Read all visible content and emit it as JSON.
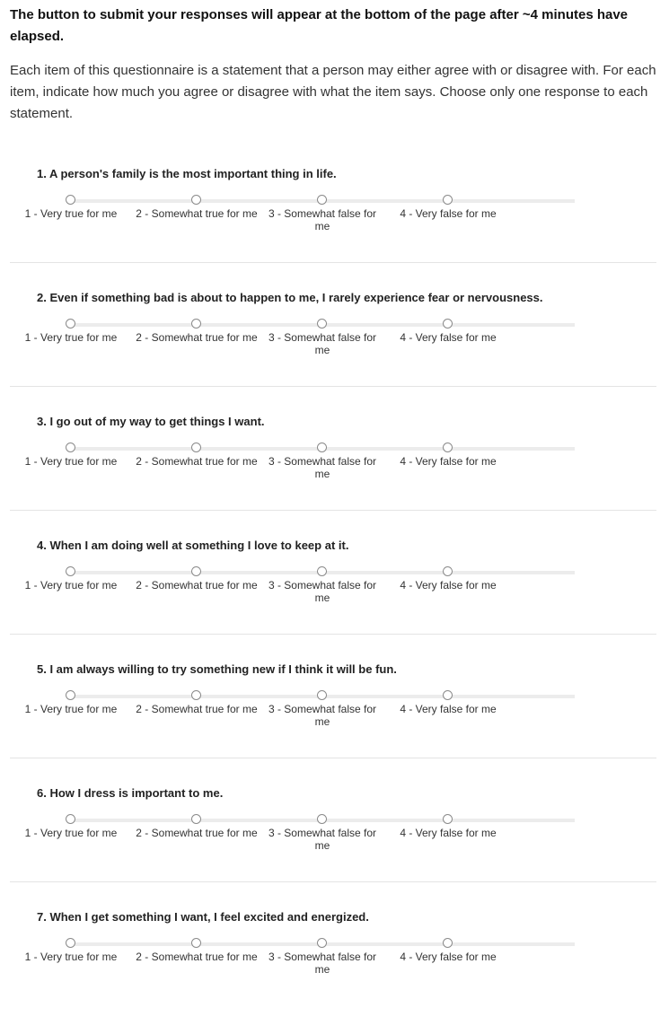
{
  "notice": "The button to submit your responses will appear at the bottom of the page after ~4 minutes have elapsed.",
  "instructions": "Each item of this questionnaire is a statement that a person may either agree with or disagree with. For each item, indicate how much you agree or disagree with what the item says. Choose only one response to each statement.",
  "options": [
    "1 - Very true for me",
    "2 - Somewhat true for me",
    "3 - Somewhat false for me",
    "4 - Very false for me"
  ],
  "questions": [
    {
      "text": "1. A person's family is the most important thing in life.",
      "selected": null
    },
    {
      "text": "2. Even if something bad is about to happen to me, I rarely experience fear or nervousness.",
      "selected": null
    },
    {
      "text": "3. I go out of my way to get things I want.",
      "selected": null
    },
    {
      "text": "4. When I am doing well at something I love to keep at it.",
      "selected": null
    },
    {
      "text": "5. I am always willing to try something new if I think it will be fun.",
      "selected": null
    },
    {
      "text": "6. How I dress is important to me.",
      "selected": null
    },
    {
      "text": "7. When I get something I want, I feel excited and energized.",
      "selected": null
    }
  ]
}
